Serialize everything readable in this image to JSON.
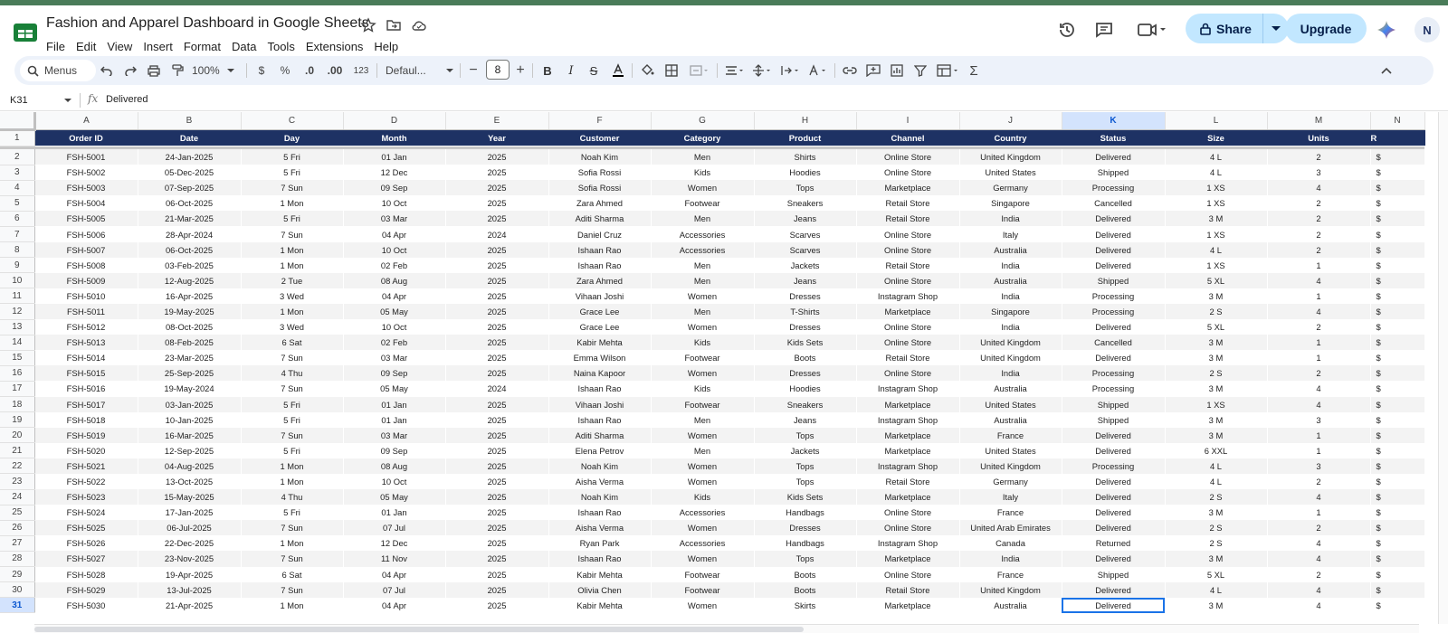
{
  "app": {
    "title": "Fashion and Apparel Dashboard in Google Sheets",
    "menu": [
      "File",
      "Edit",
      "View",
      "Insert",
      "Format",
      "Data",
      "Tools",
      "Extensions",
      "Help"
    ],
    "share_label": "Share",
    "upgrade_label": "Upgrade",
    "avatar_initials": "N"
  },
  "toolbar": {
    "search_label": "Menus",
    "zoom": "100%",
    "currency": "$",
    "percent": "%",
    "dec_decrease": ".0",
    "dec_increase": ".00",
    "number_format": "123",
    "font_name": "Defaul...",
    "font_size": "8"
  },
  "formula_bar": {
    "cell_ref": "K31",
    "fx": "fx",
    "value": "Delivered"
  },
  "sheet": {
    "columns": [
      "A",
      "B",
      "C",
      "D",
      "E",
      "F",
      "G",
      "H",
      "I",
      "J",
      "K",
      "L",
      "M",
      "N"
    ],
    "selected_column": "K",
    "selected_row": "31",
    "headers": [
      "Order ID",
      "Date",
      "Day",
      "Month",
      "Year",
      "Customer",
      "Category",
      "Product",
      "Channel",
      "Country",
      "Status",
      "Size",
      "Units",
      "R"
    ],
    "rows": [
      [
        "2",
        "FSH-5001",
        "24-Jan-2025",
        "5 Fri",
        "01 Jan",
        "2025",
        "Noah Kim",
        "Men",
        "Shirts",
        "Online Store",
        "United Kingdom",
        "Delivered",
        "4 L",
        "2",
        "$"
      ],
      [
        "3",
        "FSH-5002",
        "05-Dec-2025",
        "5 Fri",
        "12 Dec",
        "2025",
        "Sofia Rossi",
        "Kids",
        "Hoodies",
        "Online Store",
        "United States",
        "Shipped",
        "4 L",
        "3",
        "$"
      ],
      [
        "4",
        "FSH-5003",
        "07-Sep-2025",
        "7 Sun",
        "09 Sep",
        "2025",
        "Sofia Rossi",
        "Women",
        "Tops",
        "Marketplace",
        "Germany",
        "Processing",
        "1 XS",
        "4",
        "$"
      ],
      [
        "5",
        "FSH-5004",
        "06-Oct-2025",
        "1 Mon",
        "10 Oct",
        "2025",
        "Zara Ahmed",
        "Footwear",
        "Sneakers",
        "Retail Store",
        "Singapore",
        "Cancelled",
        "1 XS",
        "2",
        "$"
      ],
      [
        "6",
        "FSH-5005",
        "21-Mar-2025",
        "5 Fri",
        "03 Mar",
        "2025",
        "Aditi Sharma",
        "Men",
        "Jeans",
        "Retail Store",
        "India",
        "Delivered",
        "3 M",
        "2",
        "$"
      ],
      [
        "7",
        "FSH-5006",
        "28-Apr-2024",
        "7 Sun",
        "04 Apr",
        "2024",
        "Daniel Cruz",
        "Accessories",
        "Scarves",
        "Online Store",
        "Italy",
        "Delivered",
        "1 XS",
        "2",
        "$"
      ],
      [
        "8",
        "FSH-5007",
        "06-Oct-2025",
        "1 Mon",
        "10 Oct",
        "2025",
        "Ishaan Rao",
        "Accessories",
        "Scarves",
        "Online Store",
        "Australia",
        "Delivered",
        "4 L",
        "2",
        "$"
      ],
      [
        "9",
        "FSH-5008",
        "03-Feb-2025",
        "1 Mon",
        "02 Feb",
        "2025",
        "Ishaan Rao",
        "Men",
        "Jackets",
        "Retail Store",
        "India",
        "Delivered",
        "1 XS",
        "1",
        "$"
      ],
      [
        "10",
        "FSH-5009",
        "12-Aug-2025",
        "2 Tue",
        "08 Aug",
        "2025",
        "Zara Ahmed",
        "Men",
        "Jeans",
        "Online Store",
        "Australia",
        "Shipped",
        "5 XL",
        "4",
        "$"
      ],
      [
        "11",
        "FSH-5010",
        "16-Apr-2025",
        "3 Wed",
        "04 Apr",
        "2025",
        "Vihaan Joshi",
        "Women",
        "Dresses",
        "Instagram Shop",
        "India",
        "Processing",
        "3 M",
        "1",
        "$"
      ],
      [
        "12",
        "FSH-5011",
        "19-May-2025",
        "1 Mon",
        "05 May",
        "2025",
        "Grace Lee",
        "Men",
        "T-Shirts",
        "Marketplace",
        "Singapore",
        "Processing",
        "2 S",
        "4",
        "$"
      ],
      [
        "13",
        "FSH-5012",
        "08-Oct-2025",
        "3 Wed",
        "10 Oct",
        "2025",
        "Grace Lee",
        "Women",
        "Dresses",
        "Online Store",
        "India",
        "Delivered",
        "5 XL",
        "2",
        "$"
      ],
      [
        "14",
        "FSH-5013",
        "08-Feb-2025",
        "6 Sat",
        "02 Feb",
        "2025",
        "Kabir Mehta",
        "Kids",
        "Kids Sets",
        "Online Store",
        "United Kingdom",
        "Cancelled",
        "3 M",
        "1",
        "$"
      ],
      [
        "15",
        "FSH-5014",
        "23-Mar-2025",
        "7 Sun",
        "03 Mar",
        "2025",
        "Emma Wilson",
        "Footwear",
        "Boots",
        "Retail Store",
        "United Kingdom",
        "Delivered",
        "3 M",
        "1",
        "$"
      ],
      [
        "16",
        "FSH-5015",
        "25-Sep-2025",
        "4 Thu",
        "09 Sep",
        "2025",
        "Naina Kapoor",
        "Women",
        "Dresses",
        "Online Store",
        "India",
        "Processing",
        "2 S",
        "2",
        "$"
      ],
      [
        "17",
        "FSH-5016",
        "19-May-2024",
        "7 Sun",
        "05 May",
        "2024",
        "Ishaan Rao",
        "Kids",
        "Hoodies",
        "Instagram Shop",
        "Australia",
        "Processing",
        "3 M",
        "4",
        "$"
      ],
      [
        "18",
        "FSH-5017",
        "03-Jan-2025",
        "5 Fri",
        "01 Jan",
        "2025",
        "Vihaan Joshi",
        "Footwear",
        "Sneakers",
        "Marketplace",
        "United States",
        "Shipped",
        "1 XS",
        "4",
        "$"
      ],
      [
        "19",
        "FSH-5018",
        "10-Jan-2025",
        "5 Fri",
        "01 Jan",
        "2025",
        "Ishaan Rao",
        "Men",
        "Jeans",
        "Instagram Shop",
        "Australia",
        "Shipped",
        "3 M",
        "3",
        "$"
      ],
      [
        "20",
        "FSH-5019",
        "16-Mar-2025",
        "7 Sun",
        "03 Mar",
        "2025",
        "Aditi Sharma",
        "Women",
        "Tops",
        "Marketplace",
        "France",
        "Delivered",
        "3 M",
        "1",
        "$"
      ],
      [
        "21",
        "FSH-5020",
        "12-Sep-2025",
        "5 Fri",
        "09 Sep",
        "2025",
        "Elena Petrov",
        "Men",
        "Jackets",
        "Marketplace",
        "United States",
        "Delivered",
        "6 XXL",
        "1",
        "$"
      ],
      [
        "22",
        "FSH-5021",
        "04-Aug-2025",
        "1 Mon",
        "08 Aug",
        "2025",
        "Noah Kim",
        "Women",
        "Tops",
        "Instagram Shop",
        "United Kingdom",
        "Processing",
        "4 L",
        "3",
        "$"
      ],
      [
        "23",
        "FSH-5022",
        "13-Oct-2025",
        "1 Mon",
        "10 Oct",
        "2025",
        "Aisha Verma",
        "Women",
        "Tops",
        "Retail Store",
        "Germany",
        "Delivered",
        "4 L",
        "2",
        "$"
      ],
      [
        "24",
        "FSH-5023",
        "15-May-2025",
        "4 Thu",
        "05 May",
        "2025",
        "Noah Kim",
        "Kids",
        "Kids Sets",
        "Marketplace",
        "Italy",
        "Delivered",
        "2 S",
        "4",
        "$"
      ],
      [
        "25",
        "FSH-5024",
        "17-Jan-2025",
        "5 Fri",
        "01 Jan",
        "2025",
        "Ishaan Rao",
        "Accessories",
        "Handbags",
        "Online Store",
        "France",
        "Delivered",
        "3 M",
        "1",
        "$"
      ],
      [
        "26",
        "FSH-5025",
        "06-Jul-2025",
        "7 Sun",
        "07 Jul",
        "2025",
        "Aisha Verma",
        "Women",
        "Dresses",
        "Online Store",
        "United Arab Emirates",
        "Delivered",
        "2 S",
        "2",
        "$"
      ],
      [
        "27",
        "FSH-5026",
        "22-Dec-2025",
        "1 Mon",
        "12 Dec",
        "2025",
        "Ryan Park",
        "Accessories",
        "Handbags",
        "Instagram Shop",
        "Canada",
        "Returned",
        "2 S",
        "4",
        "$"
      ],
      [
        "28",
        "FSH-5027",
        "23-Nov-2025",
        "7 Sun",
        "11 Nov",
        "2025",
        "Ishaan Rao",
        "Women",
        "Tops",
        "Marketplace",
        "India",
        "Delivered",
        "3 M",
        "4",
        "$"
      ],
      [
        "29",
        "FSH-5028",
        "19-Apr-2025",
        "6 Sat",
        "04 Apr",
        "2025",
        "Kabir Mehta",
        "Footwear",
        "Boots",
        "Online Store",
        "France",
        "Shipped",
        "5 XL",
        "2",
        "$"
      ],
      [
        "30",
        "FSH-5029",
        "13-Jul-2025",
        "7 Sun",
        "07 Jul",
        "2025",
        "Olivia Chen",
        "Footwear",
        "Boots",
        "Retail Store",
        "United Kingdom",
        "Delivered",
        "4 L",
        "4",
        "$"
      ],
      [
        "31",
        "FSH-5030",
        "21-Apr-2025",
        "1 Mon",
        "04 Apr",
        "2025",
        "Kabir Mehta",
        "Women",
        "Skirts",
        "Marketplace",
        "Australia",
        "Delivered",
        "3 M",
        "4",
        "$"
      ]
    ]
  },
  "colors": {
    "header_band": "#1e3264",
    "top_strip": "#4a7c59",
    "share_bg": "#c2e7ff",
    "selection": "#1a73e8"
  }
}
